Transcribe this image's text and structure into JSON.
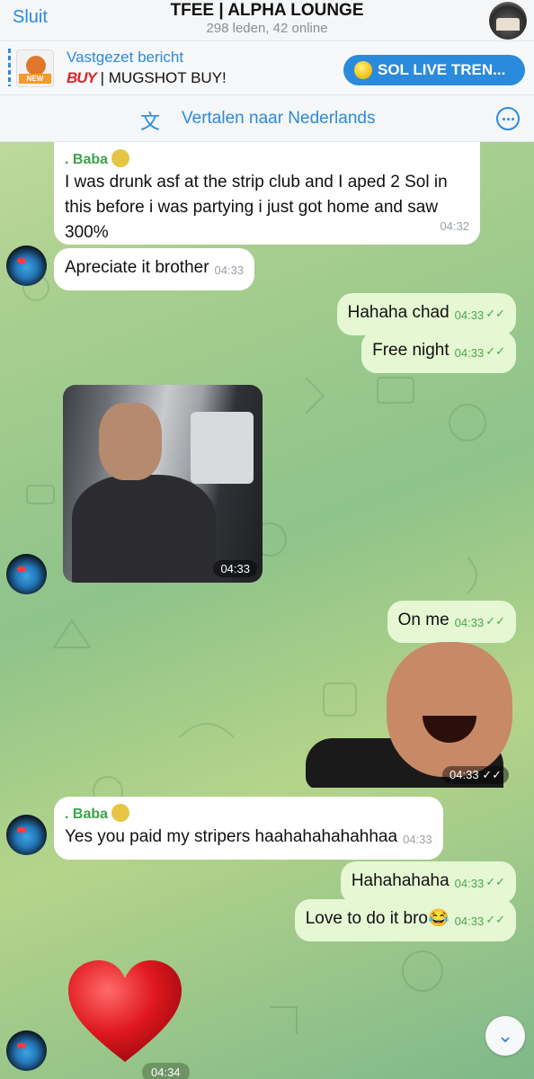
{
  "header": {
    "close_label": "Sluit",
    "title": "TFEE | ALPHA LOUNGE",
    "subtitle": "298 leden, 42 online"
  },
  "pinned": {
    "label": "Vastgezet bericht",
    "thumb_tag": "NEW BUY",
    "buy_word": "BUY",
    "text": " | MUGSHOT BUY!",
    "button_label": "SOL LIVE TREN..."
  },
  "translate": {
    "label": "Vertalen naar Nederlands"
  },
  "messages": [
    {
      "sender": ". Baba",
      "text": "I was drunk asf at the strip club and I aped 2 Sol in this before i was partying i just got home and saw 300%",
      "time": "04:32"
    },
    {
      "text": "Apreciate it brother",
      "time": "04:33"
    },
    {
      "text": "Hahaha chad",
      "time": "04:33"
    },
    {
      "text": "Free night",
      "time": "04:33"
    },
    {
      "media": "car-laughing-photo",
      "time": "04:33"
    },
    {
      "text": "On me",
      "time": "04:33"
    },
    {
      "media": "laughing-man-sticker",
      "time": "04:33"
    },
    {
      "sender": ". Baba",
      "text": "Yes you paid my stripers haahahahahahhaa",
      "time": "04:33"
    },
    {
      "text": "Hahahahaha",
      "time": "04:33"
    },
    {
      "text": "Love to do it bro😂",
      "time": "04:33"
    },
    {
      "media": "red-heart",
      "time": "04:34"
    }
  ],
  "icons": {
    "ticks": "✓✓",
    "scroll_down": "⌄"
  }
}
